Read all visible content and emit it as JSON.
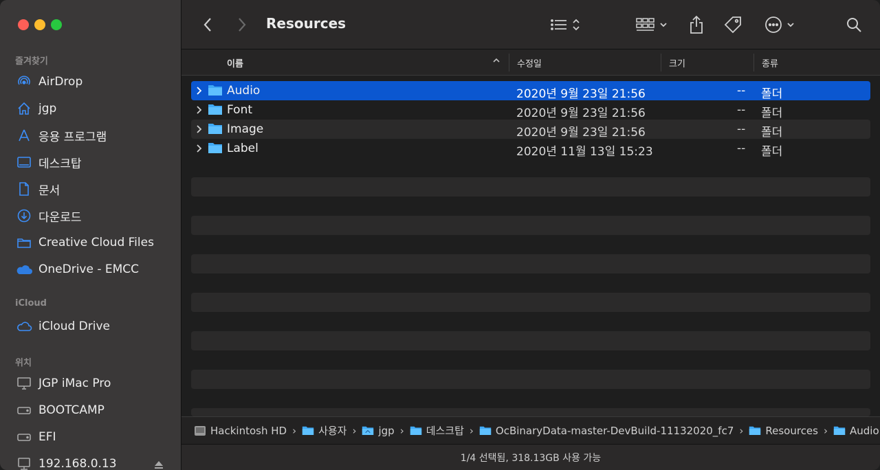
{
  "sidebar": {
    "favorites_header": "즐겨찾기",
    "favorites": [
      {
        "label": "AirDrop",
        "icon": "airdrop-icon"
      },
      {
        "label": "jgp",
        "icon": "home-icon"
      },
      {
        "label": "응용 프로그램",
        "icon": "applications-icon"
      },
      {
        "label": "데스크탑",
        "icon": "desktop-icon"
      },
      {
        "label": "문서",
        "icon": "document-icon"
      },
      {
        "label": "다운로드",
        "icon": "download-icon"
      },
      {
        "label": "Creative Cloud Files",
        "icon": "folder-icon"
      },
      {
        "label": "OneDrive - EMCC",
        "icon": "onedrive-cloud-icon"
      }
    ],
    "icloud_header": "iCloud",
    "icloud": [
      {
        "label": "iCloud Drive",
        "icon": "icloud-icon"
      }
    ],
    "locations_header": "위치",
    "locations": [
      {
        "label": "JGP iMac Pro",
        "icon": "computer-icon"
      },
      {
        "label": "BOOTCAMP",
        "icon": "drive-icon"
      },
      {
        "label": "EFI",
        "icon": "drive-icon"
      },
      {
        "label": "192.168.0.13",
        "icon": "network-server-icon"
      }
    ]
  },
  "toolbar": {
    "title": "Resources"
  },
  "columns": {
    "name": "이름",
    "modified": "수정일",
    "size": "크기",
    "kind": "종류"
  },
  "files": [
    {
      "name": "Audio",
      "modified": "2020년 9월 23일 21:56",
      "size": "--",
      "kind": "폴더",
      "selected": true
    },
    {
      "name": "Font",
      "modified": "2020년 9월 23일 21:56",
      "size": "--",
      "kind": "폴더",
      "selected": false
    },
    {
      "name": "Image",
      "modified": "2020년 9월 23일 21:56",
      "size": "--",
      "kind": "폴더",
      "selected": false
    },
    {
      "name": "Label",
      "modified": "2020년 11월 13일 15:23",
      "size": "--",
      "kind": "폴더",
      "selected": false
    }
  ],
  "path": [
    {
      "label": "Hackintosh HD",
      "icon": "hard-drive-icon"
    },
    {
      "label": "사용자",
      "icon": "folder-icon"
    },
    {
      "label": "jgp",
      "icon": "home-folder-icon"
    },
    {
      "label": "데스크탑",
      "icon": "folder-icon"
    },
    {
      "label": "OcBinaryData-master-DevBuild-11132020_fc7",
      "icon": "folder-icon"
    },
    {
      "label": "Resources",
      "icon": "folder-icon"
    },
    {
      "label": "Audio",
      "icon": "folder-icon"
    }
  ],
  "status": "1/4 선택됨, 318.13GB 사용 가능",
  "colors": {
    "selection": "#0b57d0",
    "folder": "#3fa9f5",
    "sidebar_icon": "#3d8ef7"
  }
}
